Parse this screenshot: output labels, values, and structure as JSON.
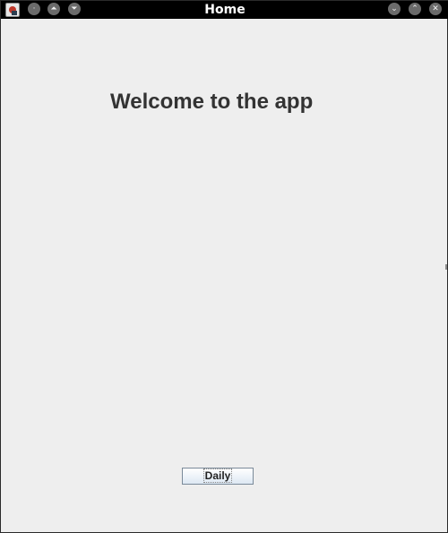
{
  "window": {
    "title": "Home"
  },
  "titlebar": {
    "left_buttons": [
      {
        "name": "menu-dot-icon",
        "glyph": "·"
      },
      {
        "name": "shade-up-icon",
        "glyph": "⏶"
      },
      {
        "name": "minimize-down-icon",
        "glyph": "⏷"
      }
    ],
    "right_buttons": [
      {
        "name": "chevron-down-icon",
        "glyph": "⌄"
      },
      {
        "name": "chevron-up-icon",
        "glyph": "⌃"
      },
      {
        "name": "close-icon",
        "glyph": "✕"
      }
    ]
  },
  "main": {
    "welcome_text": "Welcome to the app",
    "daily_button_label": "Daily"
  },
  "colors": {
    "background": "#eeeeee",
    "titlebar": "#000000",
    "text": "#333333"
  }
}
